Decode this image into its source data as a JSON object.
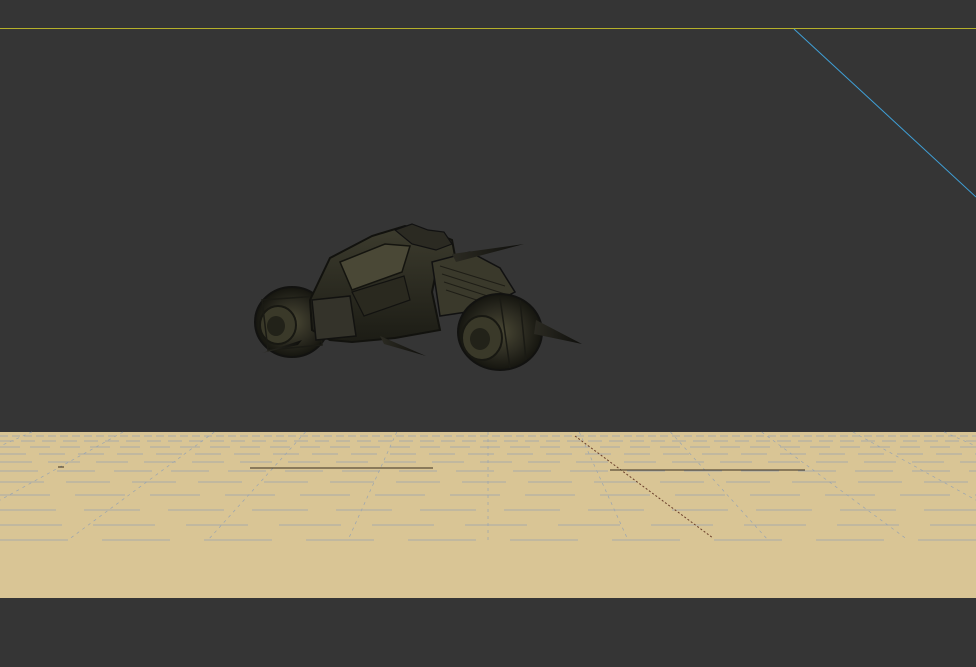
{
  "viewport": {
    "name": "3d-viewport",
    "background_color": "#353535",
    "ground_color": "#d9c595",
    "grid_line_color": "#8f9fb5",
    "horizon_line_color": "#b5b02a",
    "axis_line_color": "#3f9fd6",
    "model": "hover-bike-model"
  }
}
